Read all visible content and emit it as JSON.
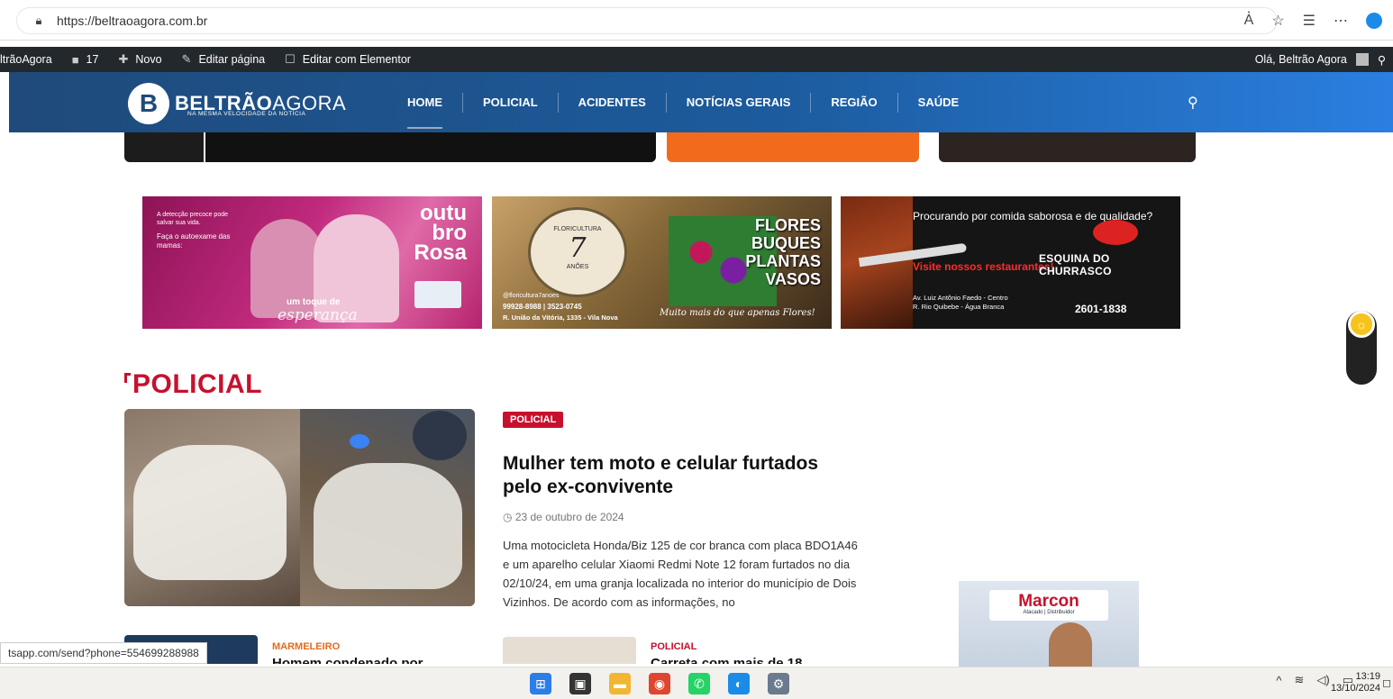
{
  "browser": {
    "url": "https://beltraoagora.com.br",
    "icons": [
      "read-aloud-icon",
      "favorite-star-icon",
      "favorites-icon",
      "more-icon",
      "edge-icon"
    ]
  },
  "wp_admin_bar": {
    "site_name": "ltrãoAgora",
    "comments_count": "17",
    "new_label": "Novo",
    "edit_page_label": "Editar página",
    "elementor_label": "Editar com Elementor",
    "greeting": "Olá, Beltrão Agora"
  },
  "header": {
    "logo_mark": "B",
    "logo_bold": "BELTRÃO",
    "logo_light": "AGORA",
    "tagline": "NA MESMA VELOCIDADE DA NOTÍCIA",
    "nav": [
      {
        "label": "HOME",
        "active": true
      },
      {
        "label": "POLICIAL"
      },
      {
        "label": "ACIDENTES"
      },
      {
        "label": "NOTÍCIAS GERAIS"
      },
      {
        "label": "REGIÃO"
      },
      {
        "label": "SAÚDE"
      }
    ]
  },
  "banners": {
    "outubro": {
      "intro": "A detecção precoce pode salvar sua vida.",
      "cta": "Faça o autoexame das mamas:",
      "brand": "outu bro Rosa",
      "tagline_a": "um toque de",
      "tagline_b": "esperança"
    },
    "floricultura": {
      "medal_top": "FLORICULTURA",
      "medal_big": "7",
      "medal_bottom": "ANÕES",
      "words": [
        "FLORES",
        "BUQUES",
        "PLANTAS",
        "VASOS"
      ],
      "instagram": "@floricultura7anoes",
      "phones": "99928-8988 | 3523-0745",
      "address": "R. União da Vitória, 1335 - Vila Nova",
      "script": "Muito mais do que apenas Flores!"
    },
    "churrasco": {
      "q1": "Procurando por comida saborosa e de qualidade?",
      "q2": "Visite nossos restaurantes!",
      "addr1": "Av. Luiz Antônio Faedo - Centro",
      "addr2": "R. Rio Quibebe - Água Branca",
      "brand": "ESQUINA DO CHURRASCO",
      "phone": "2601-1838"
    }
  },
  "section": {
    "title": "POLICIAL",
    "featured": {
      "category": "POLICIAL",
      "title": "Mulher tem moto e celular furtados pelo ex-convivente",
      "date": "23 de outubro de 2024",
      "excerpt": "Uma motocicleta Honda/Biz 125 de cor branca com placa BDO1A46 e um aparelho celular Xiaomi Redmi Note 12 foram furtados no dia 02/10/24, em uma granja localizada no interior do município de Dois Vizinhos. De acordo com as informações, no"
    },
    "small": [
      {
        "category": "MARMELEIRO",
        "title": "Homem condenado por"
      },
      {
        "category": "POLICIAL",
        "title": "Carreta com mais de 18"
      }
    ]
  },
  "ad": {
    "brand": "Marcon",
    "sub": "Atacado | Distribuidor"
  },
  "status_url": "tsapp.com/send?phone=554699288988",
  "taskbar": {
    "time": "13:19",
    "date": "13/10/2024"
  }
}
